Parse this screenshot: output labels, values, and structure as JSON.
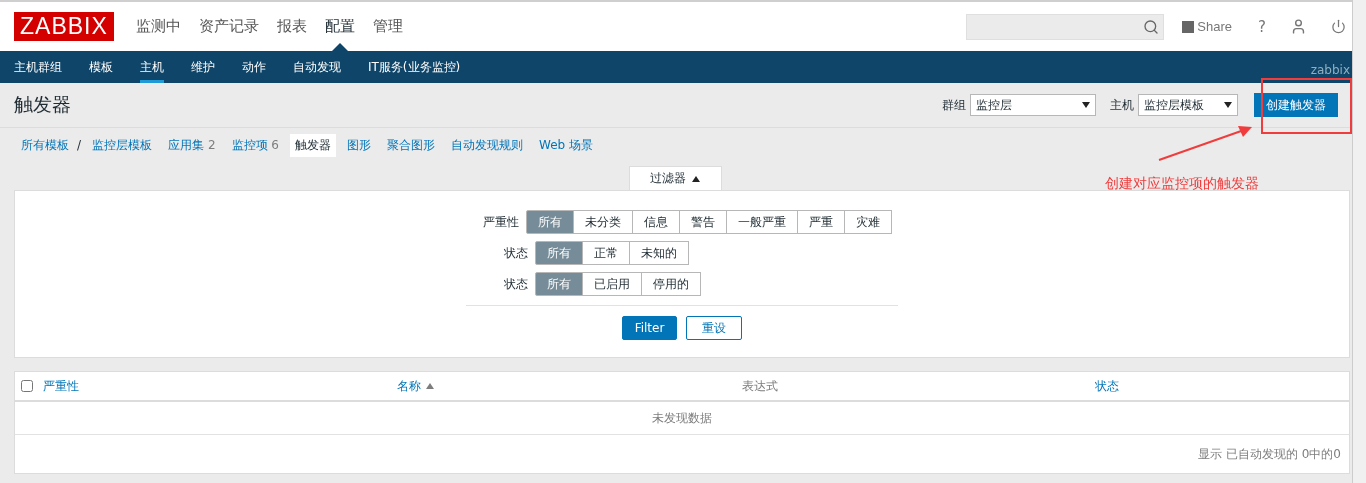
{
  "header": {
    "logo": "ZABBIX",
    "menu": [
      {
        "label": "监测中",
        "selected": false
      },
      {
        "label": "资产记录",
        "selected": false
      },
      {
        "label": "报表",
        "selected": false
      },
      {
        "label": "配置",
        "selected": true
      },
      {
        "label": "管理",
        "selected": false
      }
    ],
    "share": "Share",
    "help": "?"
  },
  "subnav": {
    "items": [
      {
        "label": "主机群组",
        "selected": false
      },
      {
        "label": "模板",
        "selected": false
      },
      {
        "label": "主机",
        "selected": true
      },
      {
        "label": "维护",
        "selected": false
      },
      {
        "label": "动作",
        "selected": false
      },
      {
        "label": "自动发现",
        "selected": false
      },
      {
        "label": "IT服务(业务监控)",
        "selected": false
      }
    ],
    "user": "zabbix"
  },
  "page": {
    "title": "触发器",
    "group": {
      "label": "群组",
      "value": "监控层"
    },
    "host": {
      "label": "主机",
      "value": "监控层模板"
    },
    "create_button": "创建触发器"
  },
  "breadcrumbs": {
    "items": [
      {
        "label": "所有模板",
        "selected": false
      },
      {
        "label": "监控层模板",
        "selected": false
      },
      {
        "label": "应用集",
        "count": "2",
        "selected": false
      },
      {
        "label": "监控项",
        "count": "6",
        "selected": false
      },
      {
        "label": "触发器",
        "selected": true
      },
      {
        "label": "图形",
        "selected": false
      },
      {
        "label": "聚合图形",
        "selected": false
      },
      {
        "label": "自动发现规则",
        "selected": false
      },
      {
        "label": "Web 场景",
        "selected": false
      }
    ],
    "separator": "/"
  },
  "filter": {
    "tab": "过滤器",
    "expanded": true,
    "rows": [
      {
        "label": "严重性",
        "options": [
          {
            "label": "所有",
            "selected": true
          },
          {
            "label": "未分类",
            "selected": false
          },
          {
            "label": "信息",
            "selected": false
          },
          {
            "label": "警告",
            "selected": false
          },
          {
            "label": "一般严重",
            "selected": false
          },
          {
            "label": "严重",
            "selected": false
          },
          {
            "label": "灾难",
            "selected": false
          }
        ]
      },
      {
        "label": "状态",
        "options": [
          {
            "label": "所有",
            "selected": true
          },
          {
            "label": "正常",
            "selected": false
          },
          {
            "label": "未知的",
            "selected": false
          }
        ]
      },
      {
        "label": "状态",
        "options": [
          {
            "label": "所有",
            "selected": true
          },
          {
            "label": "已启用",
            "selected": false
          },
          {
            "label": "停用的",
            "selected": false
          }
        ]
      }
    ],
    "apply": "Filter",
    "reset": "重设"
  },
  "table": {
    "select_all": false,
    "columns": [
      {
        "label": "严重性",
        "kind": "link",
        "sorted": false
      },
      {
        "label": "名称",
        "kind": "link",
        "sorted": true
      },
      {
        "label": "表达式",
        "kind": "plain",
        "sorted": false
      },
      {
        "label": "状态",
        "kind": "link",
        "sorted": false
      }
    ],
    "empty": "未发现数据",
    "footer": "显示 已自动发现的 0中的0"
  },
  "annotation": {
    "text": "创建对应监控项的触发器"
  }
}
